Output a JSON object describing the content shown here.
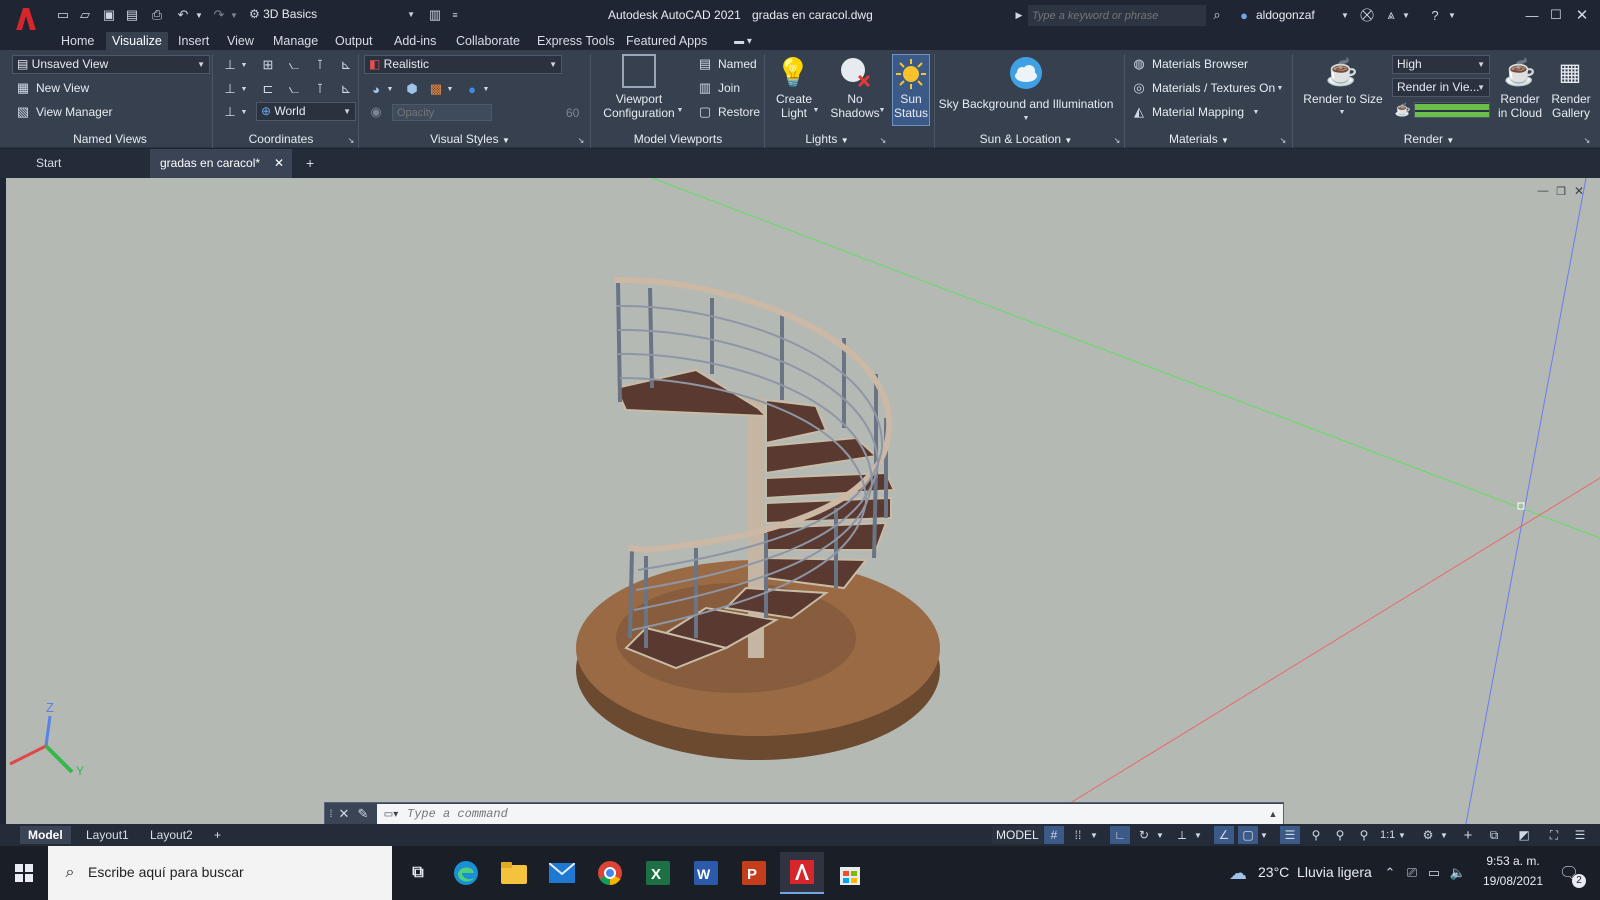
{
  "titlebar": {
    "app_title": "Autodesk AutoCAD 2021",
    "file_name": "gradas en caracol.dwg",
    "workspace": "3D Basics",
    "search_placeholder": "Type a keyword or phrase",
    "user": "aldogonzaf"
  },
  "ribbon_tabs": [
    "Home",
    "Visualize",
    "Insert",
    "View",
    "Manage",
    "Output",
    "Add-ins",
    "Collaborate",
    "Express Tools",
    "Featured Apps"
  ],
  "active_tab": "Visualize",
  "named_views": {
    "view_dropdown": "Unsaved View",
    "new_view": "New View",
    "view_manager": "View Manager",
    "panel_label": "Named Views"
  },
  "coordinates": {
    "ucs_dropdown": "World",
    "panel_label": "Coordinates"
  },
  "visual_styles": {
    "style_dropdown": "Realistic",
    "opacity_placeholder": "Opacity",
    "opacity_value": "60",
    "panel_label": "Visual Styles"
  },
  "model_viewports": {
    "viewport_config": "Viewport Configuration",
    "named": "Named",
    "join": "Join",
    "restore": "Restore",
    "panel_label": "Model Viewports"
  },
  "lights": {
    "create_light": "Create Light",
    "no_shadows": "No Shadows",
    "sun_status": "Sun Status",
    "panel_label": "Lights"
  },
  "sun_location": {
    "sky": "Sky Background and Illumination",
    "panel_label": "Sun & Location"
  },
  "materials": {
    "browser": "Materials Browser",
    "textures": "Materials / Textures On",
    "mapping": "Material Mapping",
    "panel_label": "Materials"
  },
  "render": {
    "render_to_size": "Render to Size",
    "quality": "High",
    "render_in": "Render in Vie...",
    "render_in_cloud": "Render in Cloud",
    "render_gallery": "Render Gallery",
    "panel_label": "Render"
  },
  "doc_tabs": [
    "Start",
    "gradas en caracol*"
  ],
  "command_placeholder": "Type a command",
  "layout_tabs": [
    "Model",
    "Layout1",
    "Layout2"
  ],
  "status": {
    "model": "MODEL",
    "scale": "1:1"
  },
  "taskbar": {
    "search_placeholder": "Escribe aquí para buscar",
    "weather": "23°C  Lluvia ligera",
    "time": "9:53 a. m.",
    "date": "19/08/2021",
    "notifications": "2"
  },
  "colors": {
    "accent": "#3c5a88",
    "ribbon_bg": "#36404f",
    "viewport_bg": "#b4b9b4",
    "autocad_red": "#d7262b"
  }
}
